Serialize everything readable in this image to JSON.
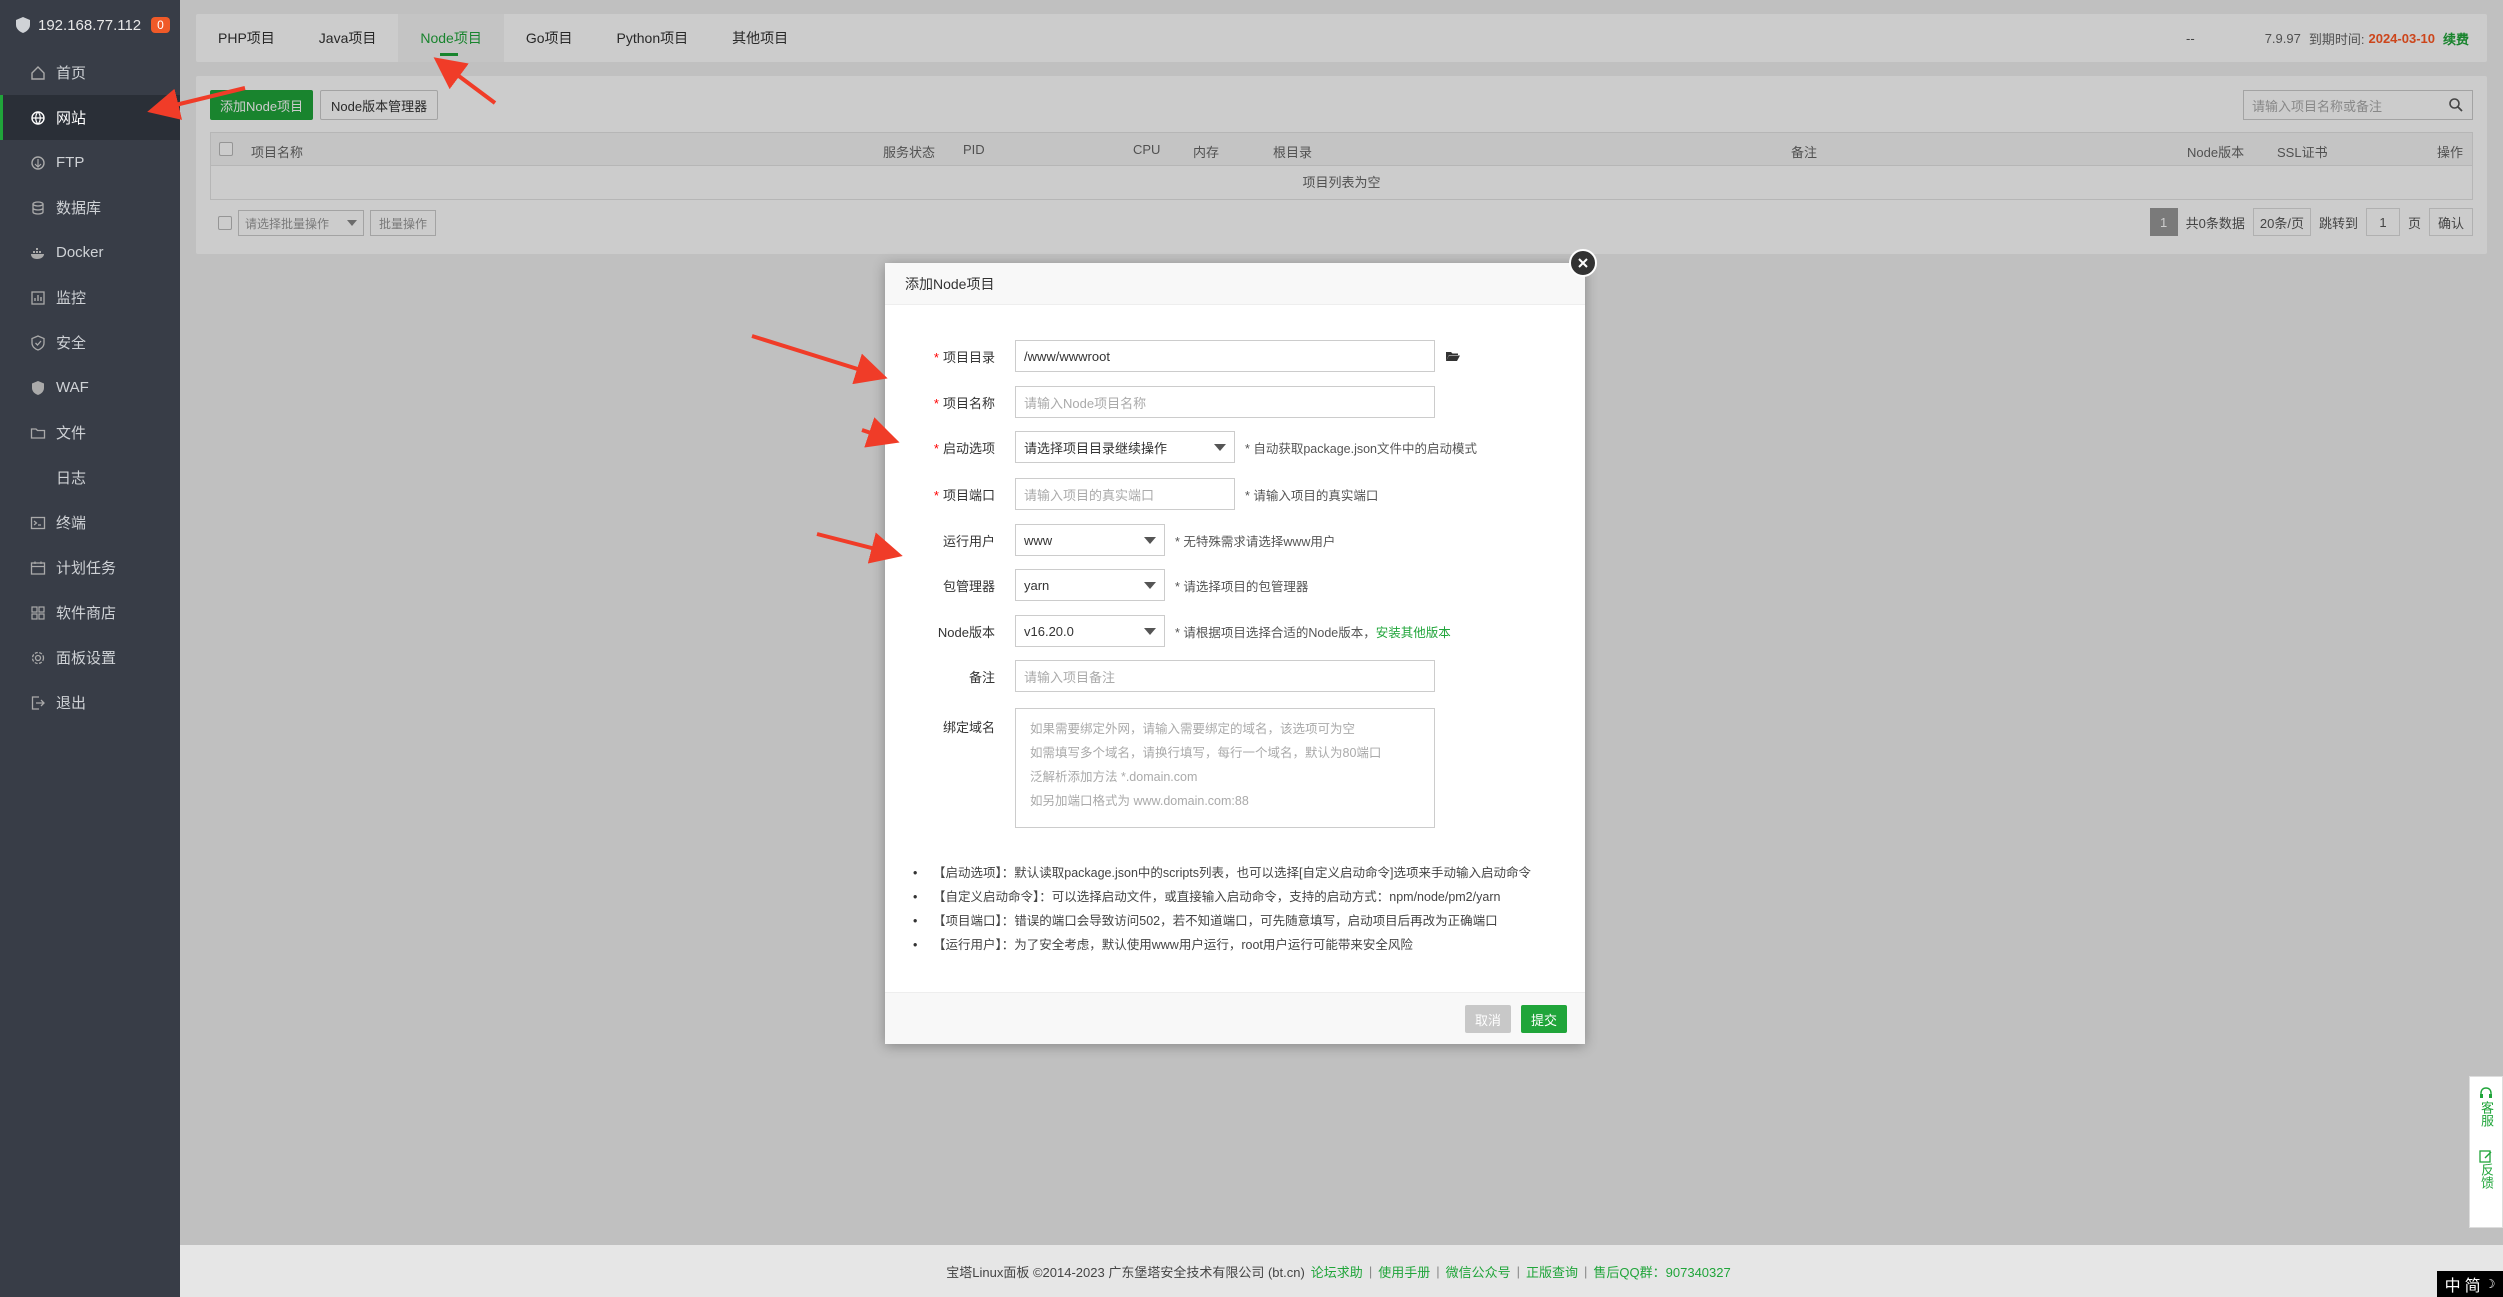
{
  "sidebar": {
    "host": "192.168.77.112",
    "badge": "0",
    "items": [
      {
        "label": "首页"
      },
      {
        "label": "网站"
      },
      {
        "label": "FTP"
      },
      {
        "label": "数据库"
      },
      {
        "label": "Docker"
      },
      {
        "label": "监控"
      },
      {
        "label": "安全"
      },
      {
        "label": "WAF"
      },
      {
        "label": "文件"
      },
      {
        "label": "日志"
      },
      {
        "label": "终端"
      },
      {
        "label": "计划任务"
      },
      {
        "label": "软件商店"
      },
      {
        "label": "面板设置"
      },
      {
        "label": "退出"
      }
    ]
  },
  "tabs": [
    "PHP项目",
    "Java项目",
    "Node项目",
    "Go项目",
    "Python项目",
    "其他项目"
  ],
  "topinfo": {
    "dash": "--",
    "version": "7.9.97",
    "expire_label": "到期时间:",
    "expire_date": "2024-03-10",
    "renew": "续费"
  },
  "toolbar": {
    "add_node": "添加Node项目",
    "node_version_mgr": "Node版本管理器",
    "search_placeholder": "请输入项目名称或备注"
  },
  "table": {
    "headers": [
      "项目名称",
      "服务状态",
      "PID",
      "CPU",
      "内存",
      "根目录",
      "备注",
      "Node版本",
      "SSL证书",
      "操作"
    ],
    "empty": "项目列表为空"
  },
  "batch": {
    "select": "请选择批量操作",
    "button": "批量操作"
  },
  "pager": {
    "page": "1",
    "total": "共0条数据",
    "per_page": "20条/页",
    "jump_label": "跳转到",
    "jump_value": "1",
    "page_unit": "页",
    "confirm": "确认"
  },
  "modal": {
    "title": "添加Node项目",
    "fields": {
      "dir_label": "项目目录",
      "dir_value": "/www/wwwroot",
      "name_label": "项目名称",
      "name_placeholder": "请输入Node项目名称",
      "start_label": "启动选项",
      "start_value": "请选择项目目录继续操作",
      "start_hint": "* 自动获取package.json文件中的启动模式",
      "port_label": "项目端口",
      "port_placeholder": "请输入项目的真实端口",
      "port_hint": "* 请输入项目的真实端口",
      "user_label": "运行用户",
      "user_value": "www",
      "user_hint": "* 无特殊需求请选择www用户",
      "pm_label": "包管理器",
      "pm_value": "yarn",
      "pm_hint": "* 请选择项目的包管理器",
      "nodever_label": "Node版本",
      "nodever_value": "v16.20.0",
      "nodever_hint": "* 请根据项目选择合适的Node版本，",
      "nodever_link": "安装其他版本",
      "remark_label": "备注",
      "remark_placeholder": "请输入项目备注",
      "domain_label": "绑定域名",
      "domain_lines": [
        "如果需要绑定外网，请输入需要绑定的域名，该选项可为空",
        "如需填写多个域名，请换行填写，每行一个域名，默认为80端口",
        "泛解析添加方法 *.domain.com",
        "如另加端口格式为 www.domain.com:88"
      ]
    },
    "notes": [
      "【启动选项】：默认读取package.json中的scripts列表，也可以选择[自定义启动命令]选项来手动输入启动命令",
      "【自定义启动命令】：可以选择启动文件，或直接输入启动命令，支持的启动方式：npm/node/pm2/yarn",
      "【项目端口】：错误的端口会导致访问502，若不知道端口，可先随意填写，启动项目后再改为正确端口",
      "【运行用户】：为了安全考虑，默认使用www用户运行，root用户运行可能带来安全风险"
    ],
    "cancel": "取消",
    "submit": "提交"
  },
  "footer": {
    "copyright": "宝塔Linux面板 ©2014-2023 广东堡塔安全技术有限公司 (bt.cn)",
    "links": [
      "论坛求助",
      "使用手册",
      "微信公众号",
      "正版查询",
      "售后QQ群：907340327"
    ]
  },
  "sidefloat": {
    "service": "客服",
    "feedback": "反馈"
  },
  "ime": {
    "lang": "中",
    "mode": "简"
  },
  "colors": {
    "accent": "#20a53a",
    "sidebar": "#383d47",
    "arrow": "#f03c28"
  }
}
